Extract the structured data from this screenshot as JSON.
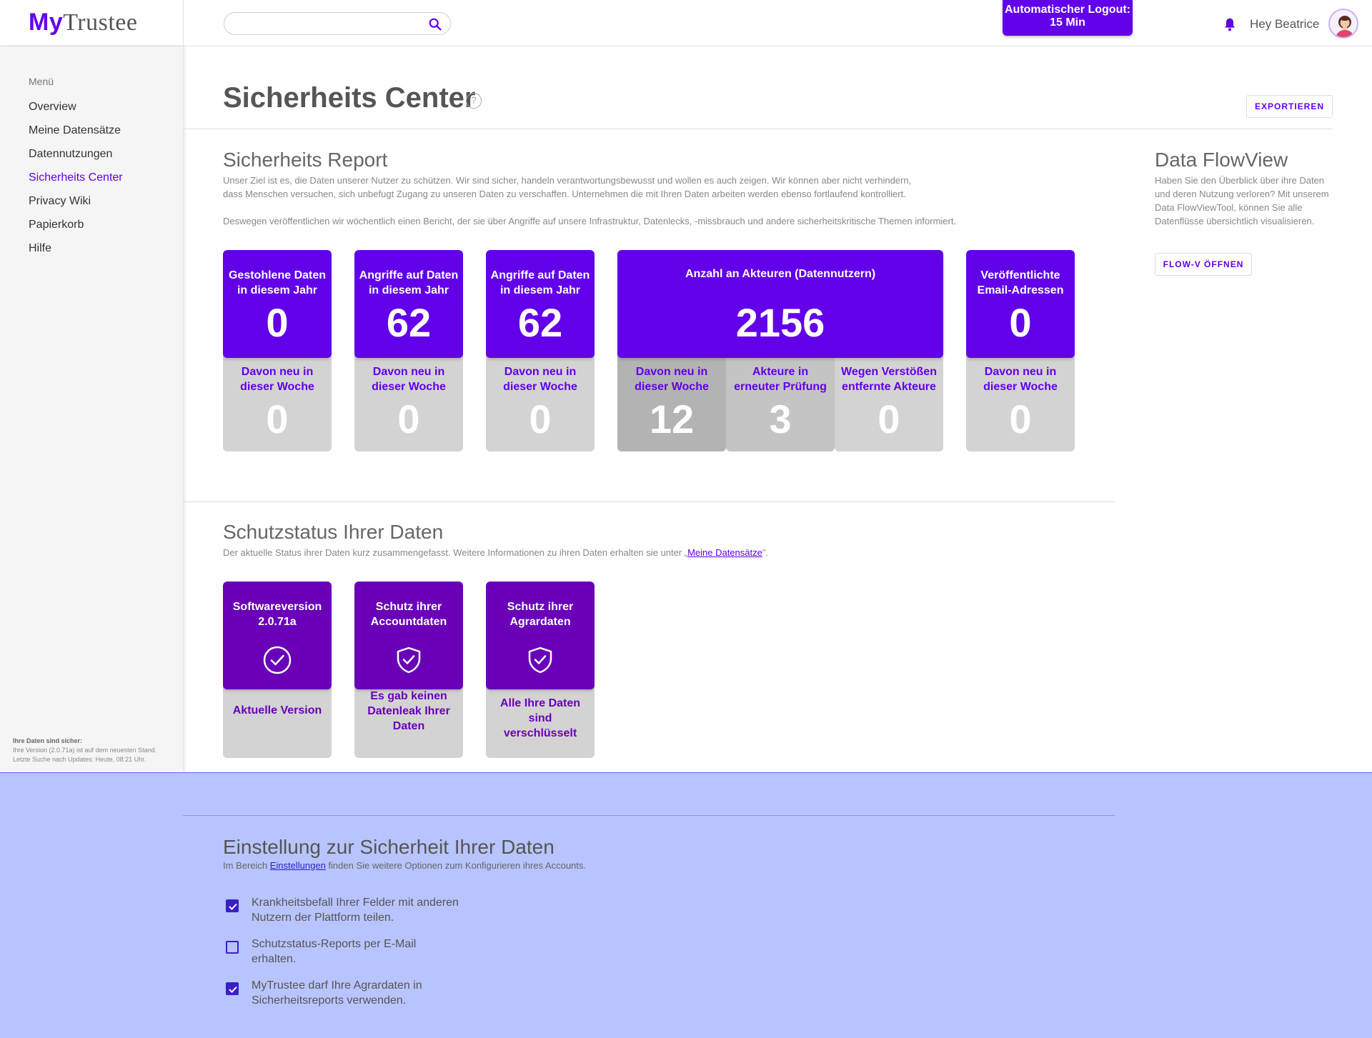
{
  "app": {
    "logo_part1": "My",
    "logo_part2": "Trustee"
  },
  "header": {
    "search_placeholder": "",
    "logout_line1": "Automatischer Logout:",
    "logout_line2": "15 Min",
    "greeting": "Hey Beatrice"
  },
  "sidebar": {
    "menu_title": "Menü",
    "items": [
      {
        "label": "Overview"
      },
      {
        "label": "Meine Datensätze"
      },
      {
        "label": "Datennutzungen"
      },
      {
        "label": "Sicherheits Center"
      },
      {
        "label": "Privacy Wiki"
      },
      {
        "label": "Papierkorb"
      },
      {
        "label": "Hilfe"
      }
    ],
    "active_item": "Sicherheits Center",
    "footer_title": "Ihre Daten sind sicher:",
    "footer_line1": "Ihre Version (2.0.71a) ist auf dem neuesten Stand.",
    "footer_line2": "Letzte Suche nach Updates: Heute, 08:21 Uhr."
  },
  "page": {
    "title": "Sicherheits Center",
    "help": "?",
    "export_label": "EXPORTIEREN"
  },
  "report": {
    "title": "Sicherheits Report",
    "para1_line1": "Unser Ziel ist es, die Daten unserer Nutzer zu schützen. Wir sind sicher, handeln verantwortungsbewusst und wollen es auch zeigen. Wir können aber nicht verhindern,",
    "para1_line2": "dass Menschen versuchen, sich unbefugt Zugang zu unseren Daten zu verschaffen. Unternehmen die mit Ihren Daten arbeiten werden ebenso fortlaufend kontrolliert.",
    "para2": "Deswegen veröffentlichen wir wöchentlich einen Bericht, der sie über Angriffe auf unsere Infrastruktur, Datenlecks, -missbrauch und andere sicherheitskritische Themen informiert.",
    "cards": [
      {
        "label_l1": "Gestohlene Daten",
        "label_l2": "in diesem Jahr",
        "value": "0",
        "sub_l1": "Davon neu in",
        "sub_l2": "dieser Woche",
        "sub_value": "0"
      },
      {
        "label_l1": "Angriffe auf Daten",
        "label_l2": "in diesem Jahr",
        "value": "62",
        "sub_l1": "Davon neu in",
        "sub_l2": "dieser Woche",
        "sub_value": "0"
      },
      {
        "label_l1": "Angriffe auf Daten",
        "label_l2": "in diesem Jahr",
        "value": "62",
        "sub_l1": "Davon neu in",
        "sub_l2": "dieser Woche",
        "sub_value": "0"
      },
      {
        "label_l1": "Veröffentlichte",
        "label_l2": "Email-Adressen",
        "value": "0",
        "sub_l1": "Davon neu in",
        "sub_l2": "dieser Woche",
        "sub_value": "0"
      }
    ],
    "actors": {
      "label": "Anzahl an Akteuren (Datennutzern)",
      "value": "2156",
      "subs": [
        {
          "l1": "Davon neu in",
          "l2": "dieser Woche",
          "value": "12"
        },
        {
          "l1": "Akteure in",
          "l2": "erneuter Prüfung",
          "value": "3"
        },
        {
          "l1": "Wegen Verstößen",
          "l2": "entfernte Akteure",
          "value": "0"
        }
      ]
    }
  },
  "flowview": {
    "title": "Data FlowView",
    "text": "Haben Sie den Überblick über ihre Daten und deren Nutzung verloren? Mit unserem Data FlowViewTool, können Sie alle Datenflüsse übersichtlich visualisieren.",
    "button": "FLOW-V ÖFFNEN"
  },
  "protection": {
    "title": "Schutzstatus Ihrer Daten",
    "text_before": "Der aktuelle Status ihrer Daten kurz zusammengefasst. Weitere Informationen zu ihren Daten erhalten sie unter „",
    "link": "Meine Datensätze",
    "text_after": "\".",
    "cards": [
      {
        "l1": "Softwareversion",
        "l2": "2.0.71a",
        "icon": "check-circle-icon",
        "sub": "Aktuelle Version"
      },
      {
        "l1": "Schutz ihrer",
        "l2": "Accountdaten",
        "icon": "shield-check-icon",
        "sub": "Es gab keinen Datenleak Ihrer Daten"
      },
      {
        "l1": "Schutz ihrer",
        "l2": "Agrardaten",
        "icon": "shield-check-icon",
        "sub": "Alle Ihre Daten sind verschlüsselt"
      }
    ]
  },
  "settings": {
    "title": "Einstellung zur Sicherheit Ihrer Daten",
    "text_before": "Im Bereich ",
    "link": "Einstellungen",
    "text_after": " finden Sie weitere Optionen zum Konfigurieren ihres Accounts.",
    "options": [
      {
        "label": "Krankheitsbefall Ihrer Felder mit anderen Nutzern der Plattform teilen.",
        "checked": true
      },
      {
        "label": "Schutzstatus-Reports per E-Mail erhalten.",
        "checked": false
      },
      {
        "label": "MyTrustee darf Ihre Agrardaten in Sicherheitsreports verwenden.",
        "checked": true
      }
    ]
  },
  "colors": {
    "accent": "#6200ea",
    "status_purple": "#6a00b8",
    "card_grey": "#d3d3d3",
    "overlay": "#b3c0ff"
  }
}
